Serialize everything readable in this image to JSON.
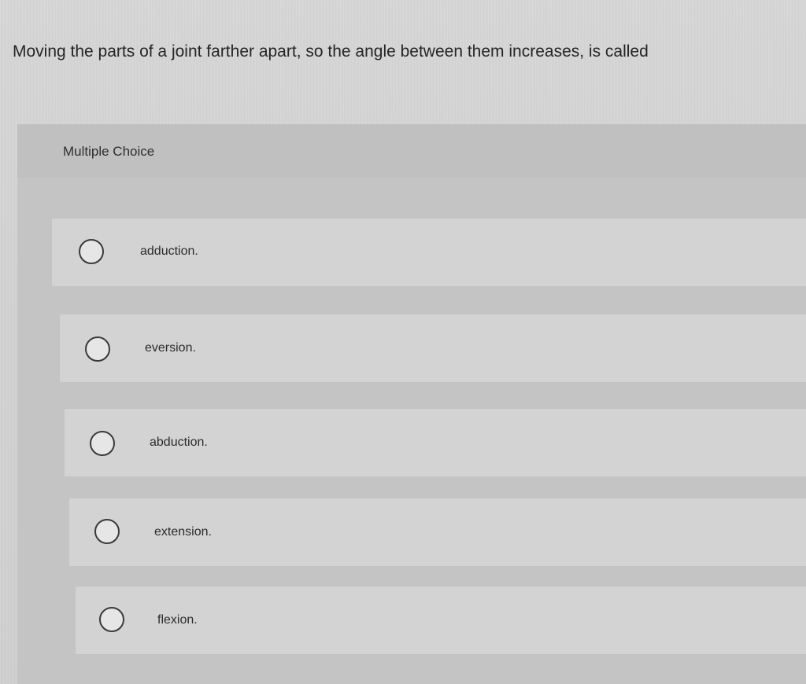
{
  "question": {
    "text": "Moving the parts of a joint farther apart, so the angle between them increases, is called"
  },
  "quiz": {
    "type_label": "Multiple Choice",
    "options": [
      {
        "label": "adduction.",
        "selected": false
      },
      {
        "label": "eversion.",
        "selected": false
      },
      {
        "label": "abduction.",
        "selected": false
      },
      {
        "label": "extension.",
        "selected": false
      },
      {
        "label": "flexion.",
        "selected": false
      }
    ]
  },
  "colors": {
    "background": "#d3d3d3",
    "panel": "#c4c4c4",
    "text": "#2b2b2b"
  }
}
